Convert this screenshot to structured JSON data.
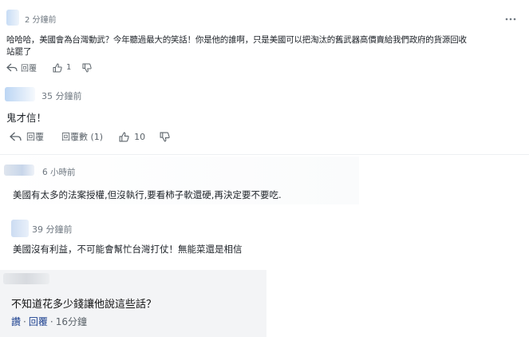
{
  "comment1": {
    "time": "2 分鐘前",
    "text_line1": "哈哈哈，美國會為台灣動武？今年聽過最大的笑話！你是他的誰啊，只是美國可以把淘汰的舊武器高價賣給我們政府的貨源回收",
    "text_line2": "站罷了",
    "reply_label": "回覆",
    "likes": "1",
    "more_icon": "more-vertical-icon"
  },
  "comment2": {
    "time": "35 分鐘前",
    "text": "鬼才信！",
    "reply_label": "回覆",
    "replies_label": "回覆數 (1)",
    "likes": "10"
  },
  "comment3": {
    "time": "6 小時前",
    "text": "美國有太多的法案授權,但沒執行,要看柿子軟還硬,再決定要不要吃."
  },
  "comment4": {
    "time": "39 分鐘前",
    "text": "美國沒有利益，不可能會幫忙台灣打仗！無能菜還是相信"
  },
  "comment5": {
    "text": "不知道花多少錢讓他說這些話？",
    "like_label": "讚",
    "reply_label": "回覆",
    "time": "16分鐘"
  },
  "colors": {
    "meta_text": "#6e7780",
    "avatar_blur": "#d7e6f8",
    "card_bg": "#f3f4f6",
    "link_blue": "#1b3f8f"
  }
}
